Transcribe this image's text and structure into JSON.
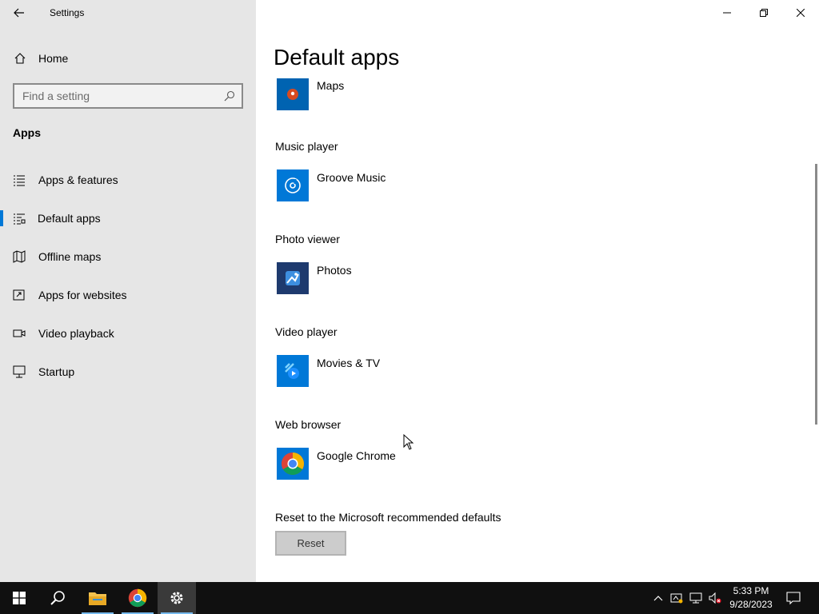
{
  "window": {
    "title": "Settings",
    "controls": {
      "minimize": "minimize",
      "restore": "restore",
      "close": "close"
    }
  },
  "nav": {
    "home_label": "Home",
    "search_placeholder": "Find a setting",
    "section_title": "Apps",
    "items": [
      {
        "label": "Apps & features",
        "icon": "list-icon",
        "active": false
      },
      {
        "label": "Default apps",
        "icon": "default-apps-icon",
        "active": true
      },
      {
        "label": "Offline maps",
        "icon": "map-icon",
        "active": false
      },
      {
        "label": "Apps for websites",
        "icon": "open-external-icon",
        "active": false
      },
      {
        "label": "Video playback",
        "icon": "video-icon",
        "active": false
      },
      {
        "label": "Startup",
        "icon": "startup-icon",
        "active": false
      }
    ]
  },
  "main": {
    "page_title": "Default apps",
    "defaults": [
      {
        "category": "",
        "app": "Maps",
        "icon": "maps-icon",
        "tile_color": "#0063b1"
      },
      {
        "category": "Music player",
        "app": "Groove Music",
        "icon": "groove-music-icon",
        "tile_color": "#0078d7"
      },
      {
        "category": "Photo viewer",
        "app": "Photos",
        "icon": "photos-icon",
        "tile_color": "#1e3a6e"
      },
      {
        "category": "Video player",
        "app": "Movies & TV",
        "icon": "movies-tv-icon",
        "tile_color": "#0078d7"
      },
      {
        "category": "Web browser",
        "app": "Google Chrome",
        "icon": "chrome-icon",
        "tile_color": "#0078d7"
      }
    ],
    "reset_label": "Reset to the Microsoft recommended defaults",
    "reset_button": "Reset"
  },
  "taskbar": {
    "items": [
      "start-icon",
      "search-icon",
      "file-explorer-icon",
      "chrome-icon",
      "settings-icon"
    ],
    "active_item": "settings-icon",
    "tray": [
      "chevron-up-icon",
      "network-alert-icon",
      "network-icon",
      "volume-muted-icon"
    ],
    "time": "5:33 PM",
    "date": "9/28/2023"
  },
  "colors": {
    "accent": "#0078d7",
    "nav_background": "#e6e6e6",
    "taskbar_background": "#101010"
  }
}
